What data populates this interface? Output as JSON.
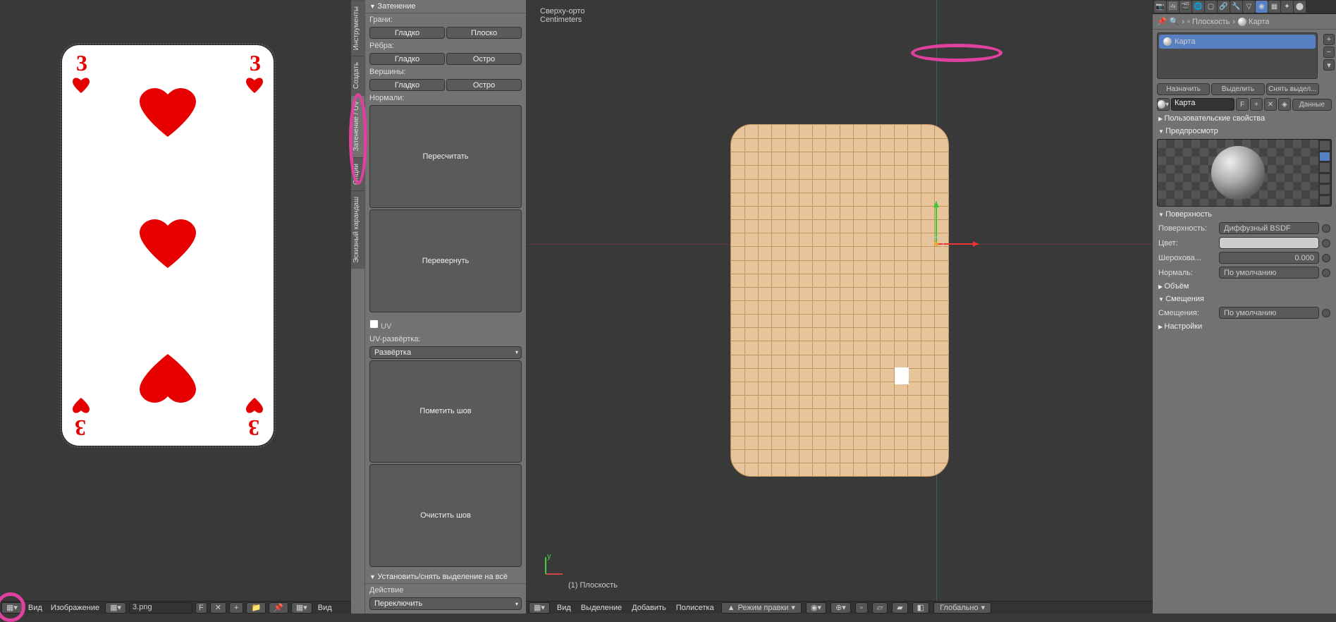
{
  "uv_editor": {
    "image_name": "3.png",
    "menu_view": "Вид",
    "menu_image": "Изображение",
    "key_f": "F",
    "card_number": "3"
  },
  "tool_shelf": {
    "tabs": [
      "Инструменты",
      "Создать",
      "Затенение / UV",
      "Опции",
      "Эскизный карандаш"
    ],
    "panel_title": "Затенение",
    "faces_label": "Грани:",
    "smooth": "Гладко",
    "flat": "Плоско",
    "edges_label": "Рёбра:",
    "sharp": "Остро",
    "verts_label": "Вершины:",
    "normals_label": "Нормали:",
    "recalc": "Пересчитать",
    "flip": "Перевернуть",
    "uv_label": "UV",
    "unwrap_label": "UV-развёртка:",
    "unwrap": "Развёртка",
    "mark_seam": "Пометить шов",
    "clear_seam": "Очистить шов",
    "deselect_panel": "Установить/снять выделение на всё",
    "action_label": "Действие",
    "action_val": "Переключить"
  },
  "viewport": {
    "view_name": "Сверху-орто",
    "units": "Centimeters",
    "object_name": "(1) Плоскость",
    "menu_view": "Вид",
    "menu_select": "Выделение",
    "menu_add": "Добавить",
    "menu_mesh": "Полисетка",
    "mode": "Режим правки",
    "orientation": "Глобально"
  },
  "properties": {
    "breadcrumb_obj": "Плоскость",
    "breadcrumb_mat": "Карта",
    "material_name": "Карта",
    "assign": "Назначить",
    "select": "Выделить",
    "deselect": "Снять выдел...",
    "name_key_f": "F",
    "data_btn": "Данные",
    "custom_props": "Пользовательские свойства",
    "preview": "Предпросмотр",
    "surface": "Поверхность",
    "surface_label": "Поверхность:",
    "surface_val": "Диффузный BSDF",
    "color_label": "Цвет:",
    "rough_label": "Шерохова...",
    "rough_val": "0.000",
    "normal_label": "Нормаль:",
    "normal_val": "По умолчанию",
    "volume": "Объём",
    "displacement": "Смещения",
    "disp_label": "Смещения:",
    "disp_val": "По умолчанию",
    "settings": "Настройки"
  }
}
